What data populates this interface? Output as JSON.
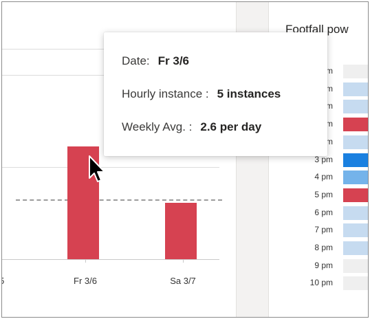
{
  "chart": {
    "x_labels": [
      "Fr 3/6",
      "Sa 3/7"
    ],
    "partial_label_left": "5",
    "bar_color": "#d64251",
    "bars": [
      {
        "label": "Fr 3/6",
        "instances": 5
      },
      {
        "label": "Sa 3/7",
        "instances": 2.5
      }
    ],
    "weekly_avg": 2.6
  },
  "right_panel": {
    "title": "Footfall pow",
    "hours": [
      {
        "label": "pm",
        "color": "#efefef"
      },
      {
        "label": "m",
        "color": "#c6dbf0"
      },
      {
        "label": "m",
        "color": "#c6dbf0"
      },
      {
        "label": "m",
        "color": "#d64251"
      },
      {
        "label": "m",
        "color": "#c6dbf0"
      },
      {
        "label": "3 pm",
        "color": "#1a80e0"
      },
      {
        "label": "4 pm",
        "color": "#74b3ea"
      },
      {
        "label": "5 pm",
        "color": "#d64251"
      },
      {
        "label": "6 pm",
        "color": "#c6dbf0"
      },
      {
        "label": "7 pm",
        "color": "#c6dbf0"
      },
      {
        "label": "8 pm",
        "color": "#c6dbf0"
      },
      {
        "label": "9 pm",
        "color": "#efefef"
      },
      {
        "label": "10 pm",
        "color": "#efefef"
      }
    ]
  },
  "tooltip": {
    "date_key": "Date:",
    "date_value": "Fr 3/6",
    "hourly_key": "Hourly instance :",
    "hourly_value": "5 instances",
    "weekly_key": "Weekly Avg. :",
    "weekly_value": "2.6 per day"
  },
  "cursor_icon": "arrow-pointer"
}
